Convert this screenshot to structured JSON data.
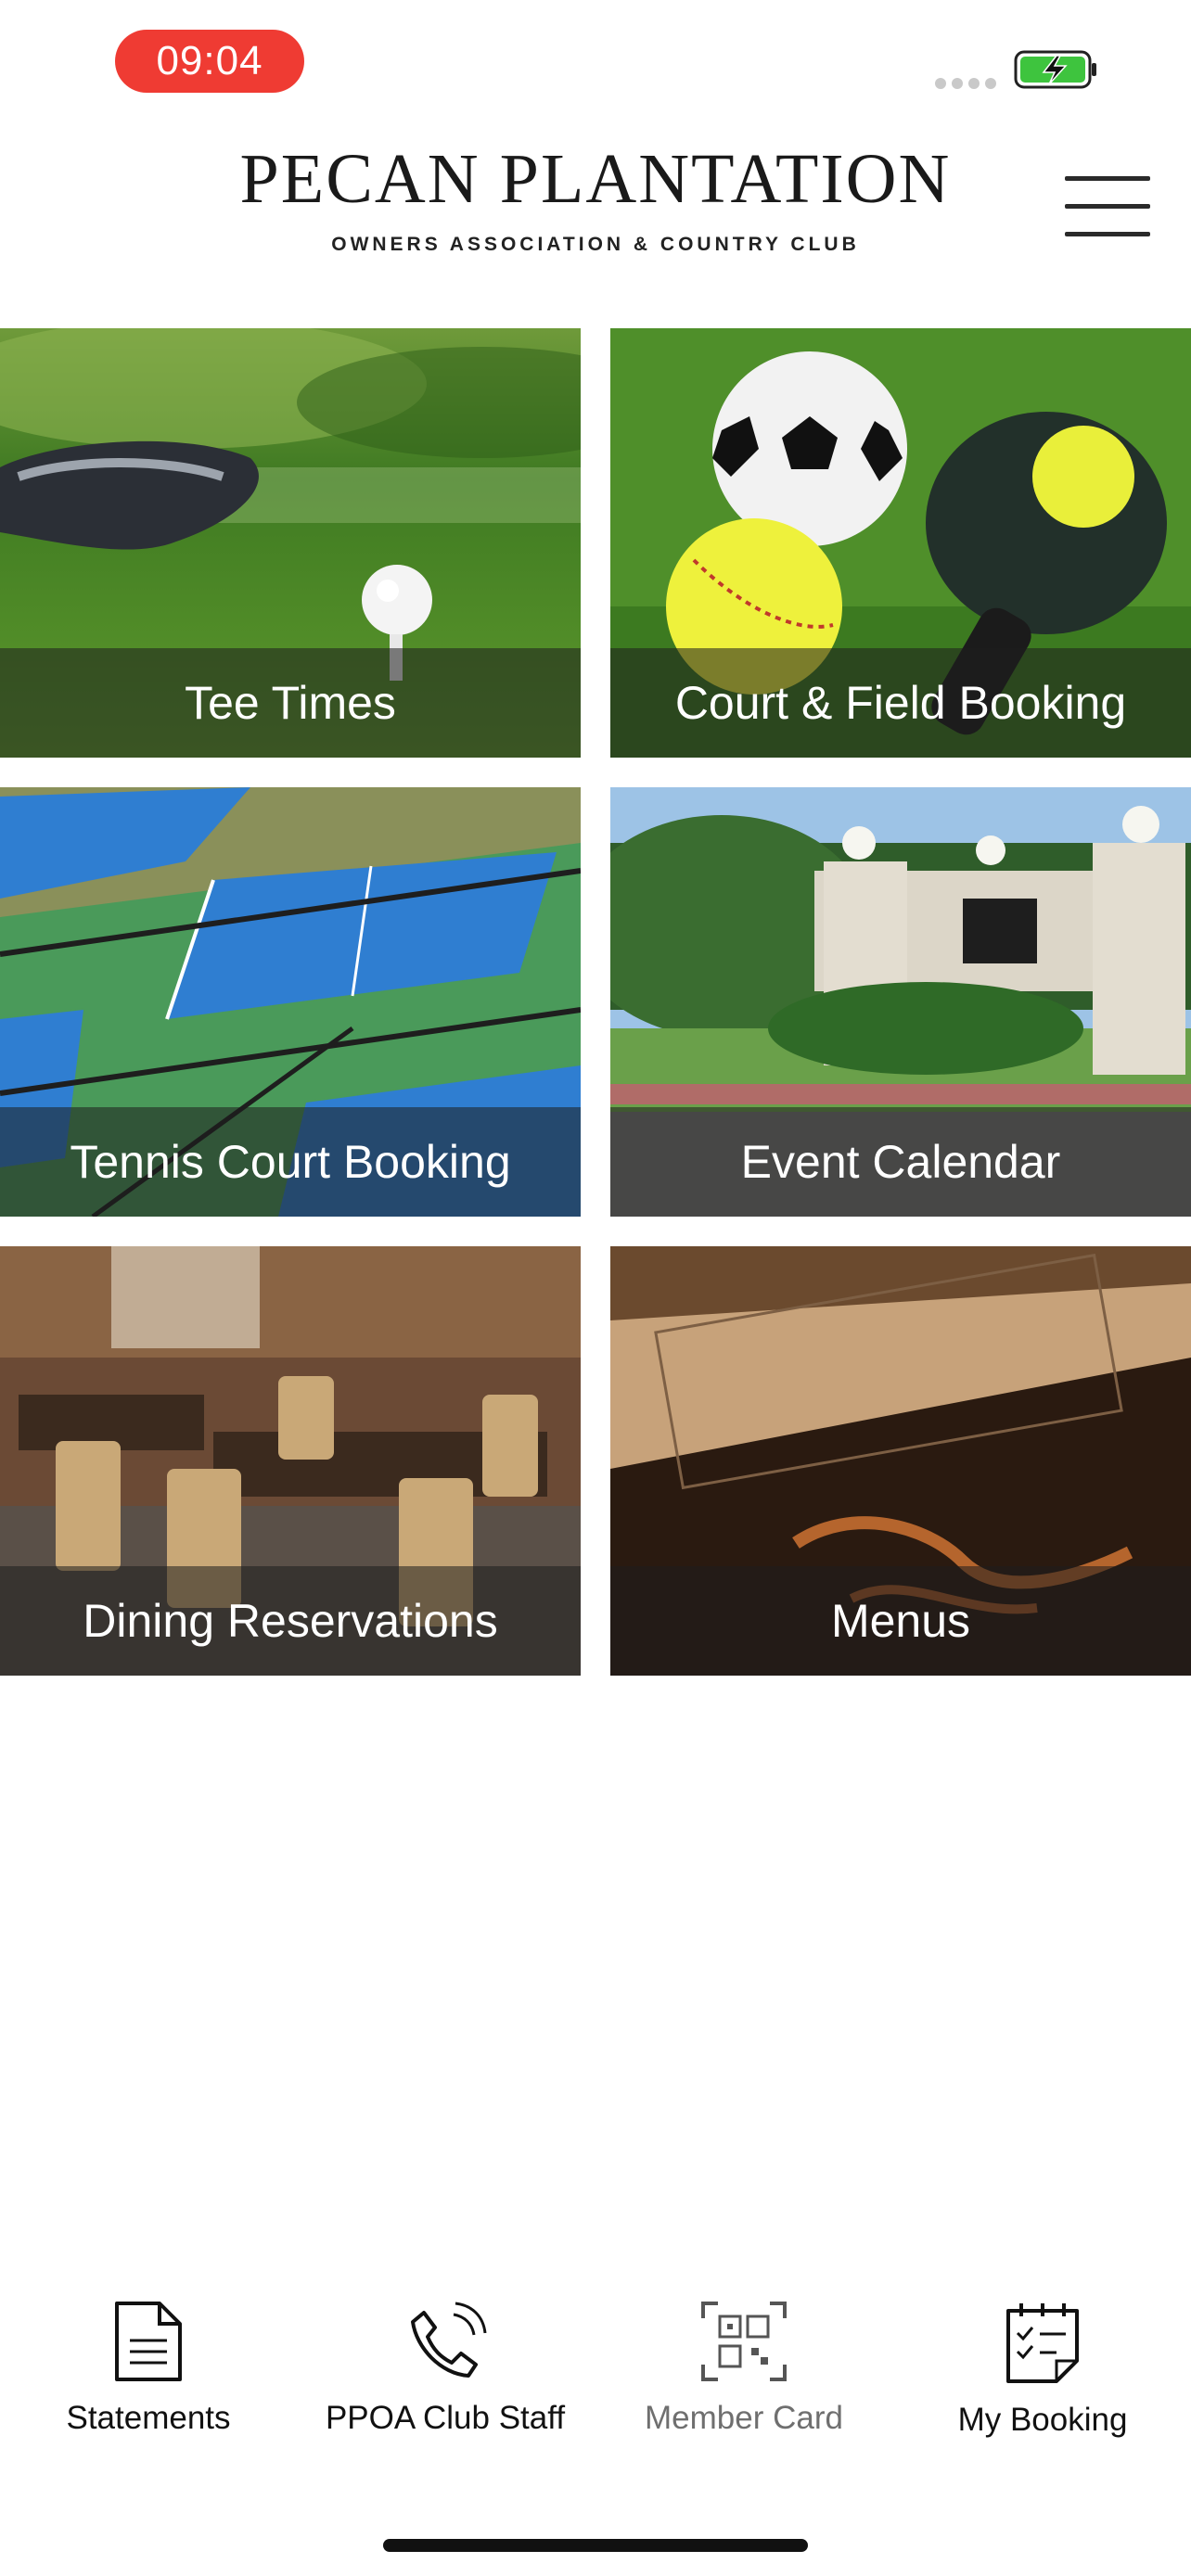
{
  "status_bar": {
    "time": "09:04"
  },
  "header": {
    "title": "PECAN PLANTATION",
    "subtitle": "OWNERS ASSOCIATION & COUNTRY CLUB",
    "menu_icon": "hamburger-menu-icon"
  },
  "tiles": [
    {
      "label": "Tee Times",
      "image": "golf club and ball on tee"
    },
    {
      "label": "Court & Field Booking",
      "image": "soccer ball, softball and pickleball paddle on grass"
    },
    {
      "label": "Tennis Court Booking",
      "image": "aerial view of tennis courts"
    },
    {
      "label": "Event Calendar",
      "image": "club entrance gate with lamps and hedges"
    },
    {
      "label": "Dining Reservations",
      "image": "restaurant dining room with tables and chairs"
    },
    {
      "label": "Menus",
      "image": "close-up of a printed menu"
    }
  ],
  "bottom_nav": [
    {
      "label": "Statements",
      "icon": "document-icon"
    },
    {
      "label": "PPOA Club Staff",
      "icon": "phone-icon"
    },
    {
      "label": "Member Card",
      "icon": "qr-code-icon"
    },
    {
      "label": "My Booking",
      "icon": "calendar-checklist-icon"
    }
  ],
  "colors": {
    "time_pill": "#ef3b33",
    "battery": "#3ec43e",
    "tile_label_bar": "rgba(30,30,30,0.55)"
  }
}
